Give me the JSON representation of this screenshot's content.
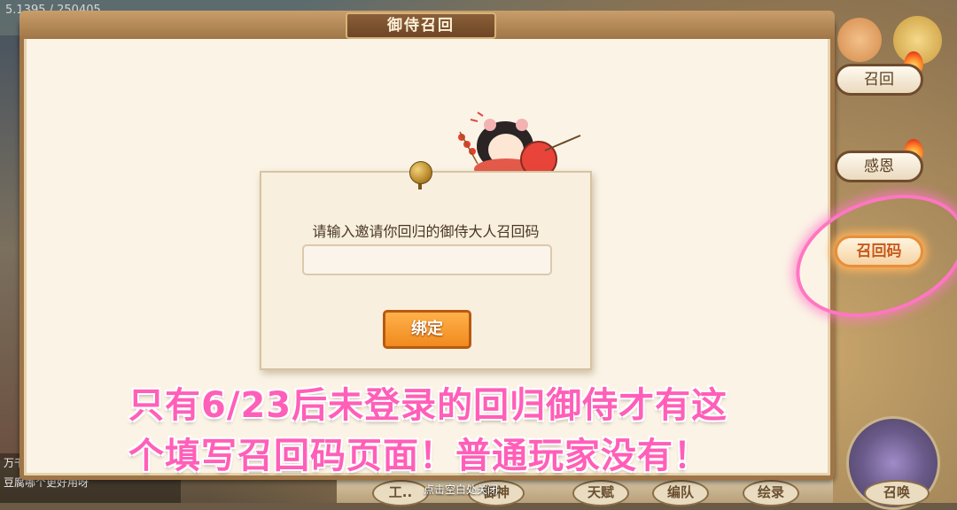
{
  "background": {
    "top_stats": "5.1395 / 250405",
    "chat_lines": [
      "万千",
      "豆腐哪个更好用呀"
    ],
    "bottom_tabs": [
      "工..",
      "御神",
      "天赋",
      "编队",
      "绘录",
      "召唤"
    ]
  },
  "dialog": {
    "title": "御侍召回",
    "prompt": "请输入邀请你回归的御侍大人召回码",
    "input_value": "",
    "input_placeholder": "",
    "bind_button": "绑定"
  },
  "side_tabs": [
    {
      "label": "召回",
      "active": false
    },
    {
      "label": "感恩",
      "active": false
    },
    {
      "label": "召回码",
      "active": true
    }
  ],
  "caption": {
    "line1": "只有6/23后未登录的回归御侍才有这",
    "line2": "个填写召回码页面！普通玩家没有！"
  },
  "close_hint": "点击空白处关闭",
  "colors": {
    "accent_orange": "#f08a1e",
    "caption_pink": "#ff5fb8",
    "panel_bg": "#fbf4e6",
    "frame_brown": "#a07647"
  }
}
